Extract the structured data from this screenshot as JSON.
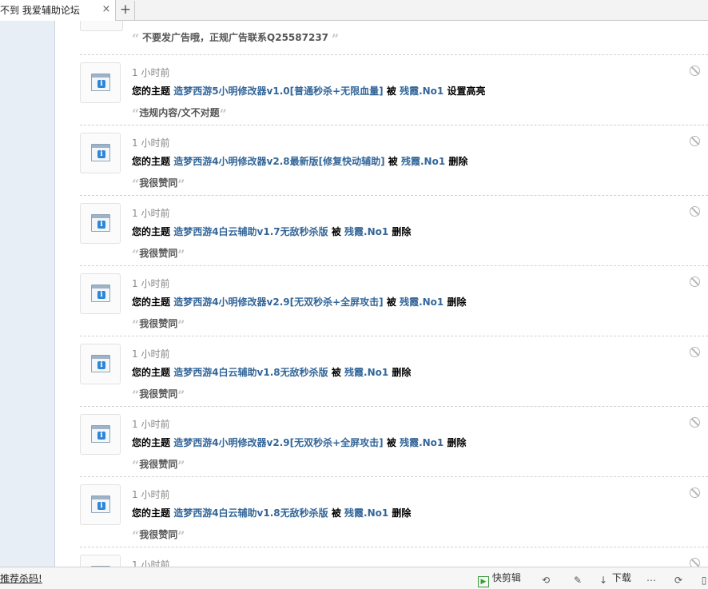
{
  "tab": {
    "title": "不到 我爱辅助论坛",
    "close": "×",
    "new": "+"
  },
  "top_partial": {
    "quote": "不要发广告哦，正规广告联系Q25587237"
  },
  "feed": [
    {
      "time": "1 小时前",
      "prefix": "您的主题",
      "topic": "造梦西游5小明修改器v1.0[普通秒杀+无限血量]",
      "by": "被",
      "user": "残霞.No1",
      "action": "设置高亮",
      "quote": "违规内容/文不对题"
    },
    {
      "time": "1 小时前",
      "prefix": "您的主题",
      "topic": "造梦西游4小明修改器v2.8最新版[修复快动辅助]",
      "by": "被",
      "user": "残霞.No1",
      "action": "删除",
      "quote": "我很赞同"
    },
    {
      "time": "1 小时前",
      "prefix": "您的主题",
      "topic": "造梦西游4白云辅助v1.7无敌秒杀版",
      "by": "被",
      "user": "残霞.No1",
      "action": "删除",
      "quote": "我很赞同"
    },
    {
      "time": "1 小时前",
      "prefix": "您的主题",
      "topic": "造梦西游4小明修改器v2.9[无双秒杀+全屏攻击]",
      "by": "被",
      "user": "残霞.No1",
      "action": "删除",
      "quote": "我很赞同"
    },
    {
      "time": "1 小时前",
      "prefix": "您的主题",
      "topic": "造梦西游4白云辅助v1.8无敌秒杀版",
      "by": "被",
      "user": "残霞.No1",
      "action": "删除",
      "quote": "我很赞同"
    },
    {
      "time": "1 小时前",
      "prefix": "您的主题",
      "topic": "造梦西游4小明修改器v2.9[无双秒杀+全屏攻击]",
      "by": "被",
      "user": "残霞.No1",
      "action": "删除",
      "quote": "我很赞同"
    },
    {
      "time": "1 小时前",
      "prefix": "您的主题",
      "topic": "造梦西游4白云辅助v1.8无敌秒杀版",
      "by": "被",
      "user": "残霞.No1",
      "action": "删除",
      "quote": "我很赞同"
    },
    {
      "time": "1 小时前"
    }
  ],
  "quote_marks": {
    "open": "“",
    "close": "”"
  },
  "statusbar": {
    "left_text": "推荐杀码!",
    "clip_label": "快剪辑",
    "download_label": "下载",
    "icons": [
      "clip-icon",
      "refresh-icon",
      "pin-icon",
      "download-icon",
      "more-icon",
      "sync-icon",
      "window-icon"
    ]
  },
  "colors": {
    "link": "#336699",
    "timestamp": "#888888",
    "left_pane": "#e8eef5"
  }
}
